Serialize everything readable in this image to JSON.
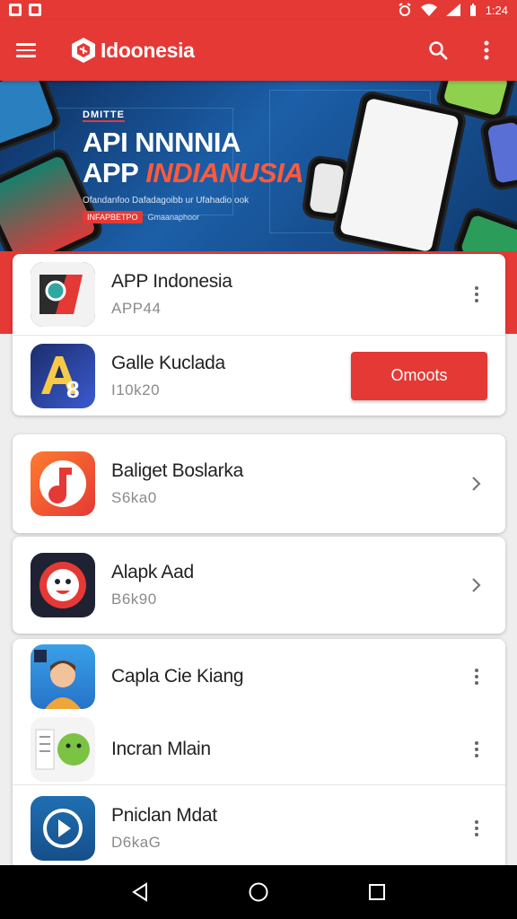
{
  "status_bar": {
    "time": "1:24",
    "left_icons": [
      "notification-icon",
      "notification-icon"
    ],
    "right_icons": [
      "alarm-icon",
      "wifi-icon",
      "signal-icon",
      "battery-icon"
    ]
  },
  "app_bar": {
    "title": "Idoonesia",
    "icons": [
      "menu-icon",
      "search-icon",
      "more-vert-icon"
    ]
  },
  "banner": {
    "kicker": "DMITTE",
    "headline_1": "API NNNNIA",
    "headline_2_a": "APP",
    "headline_2_b": "INDIANUSIA",
    "subtitle": "Ofandanfoo Dafadagoibb ur Ufahadio ook",
    "tag": "INFAPBETPO",
    "tag_2": "Gmaanaphoor"
  },
  "apps": [
    {
      "title": "APP Indonesia",
      "subtitle": "APP44",
      "trailing": "more"
    },
    {
      "title": "Galle Kuclada",
      "subtitle": "I10k20",
      "trailing": "button",
      "button_label": "Omoots"
    },
    {
      "title": "Baliget Boslarka",
      "subtitle": "S6ka0",
      "trailing": "chevron"
    },
    {
      "title": "Alapk Aad",
      "subtitle": "B6k90",
      "trailing": "chevron"
    },
    {
      "title": "Capla Cie Kiang",
      "subtitle": "",
      "trailing": "more"
    },
    {
      "title": "Incran Mlain",
      "subtitle": "",
      "trailing": "more"
    },
    {
      "title": "Pniclan Mdat",
      "subtitle": "D6kaG",
      "trailing": "more"
    }
  ],
  "nav_bar": {
    "icons": [
      "back-icon",
      "home-icon",
      "recents-icon"
    ]
  },
  "colors": {
    "primary": "#e53935",
    "banner_dark": "#0d2e5e",
    "banner_light": "#1c5fa8"
  }
}
